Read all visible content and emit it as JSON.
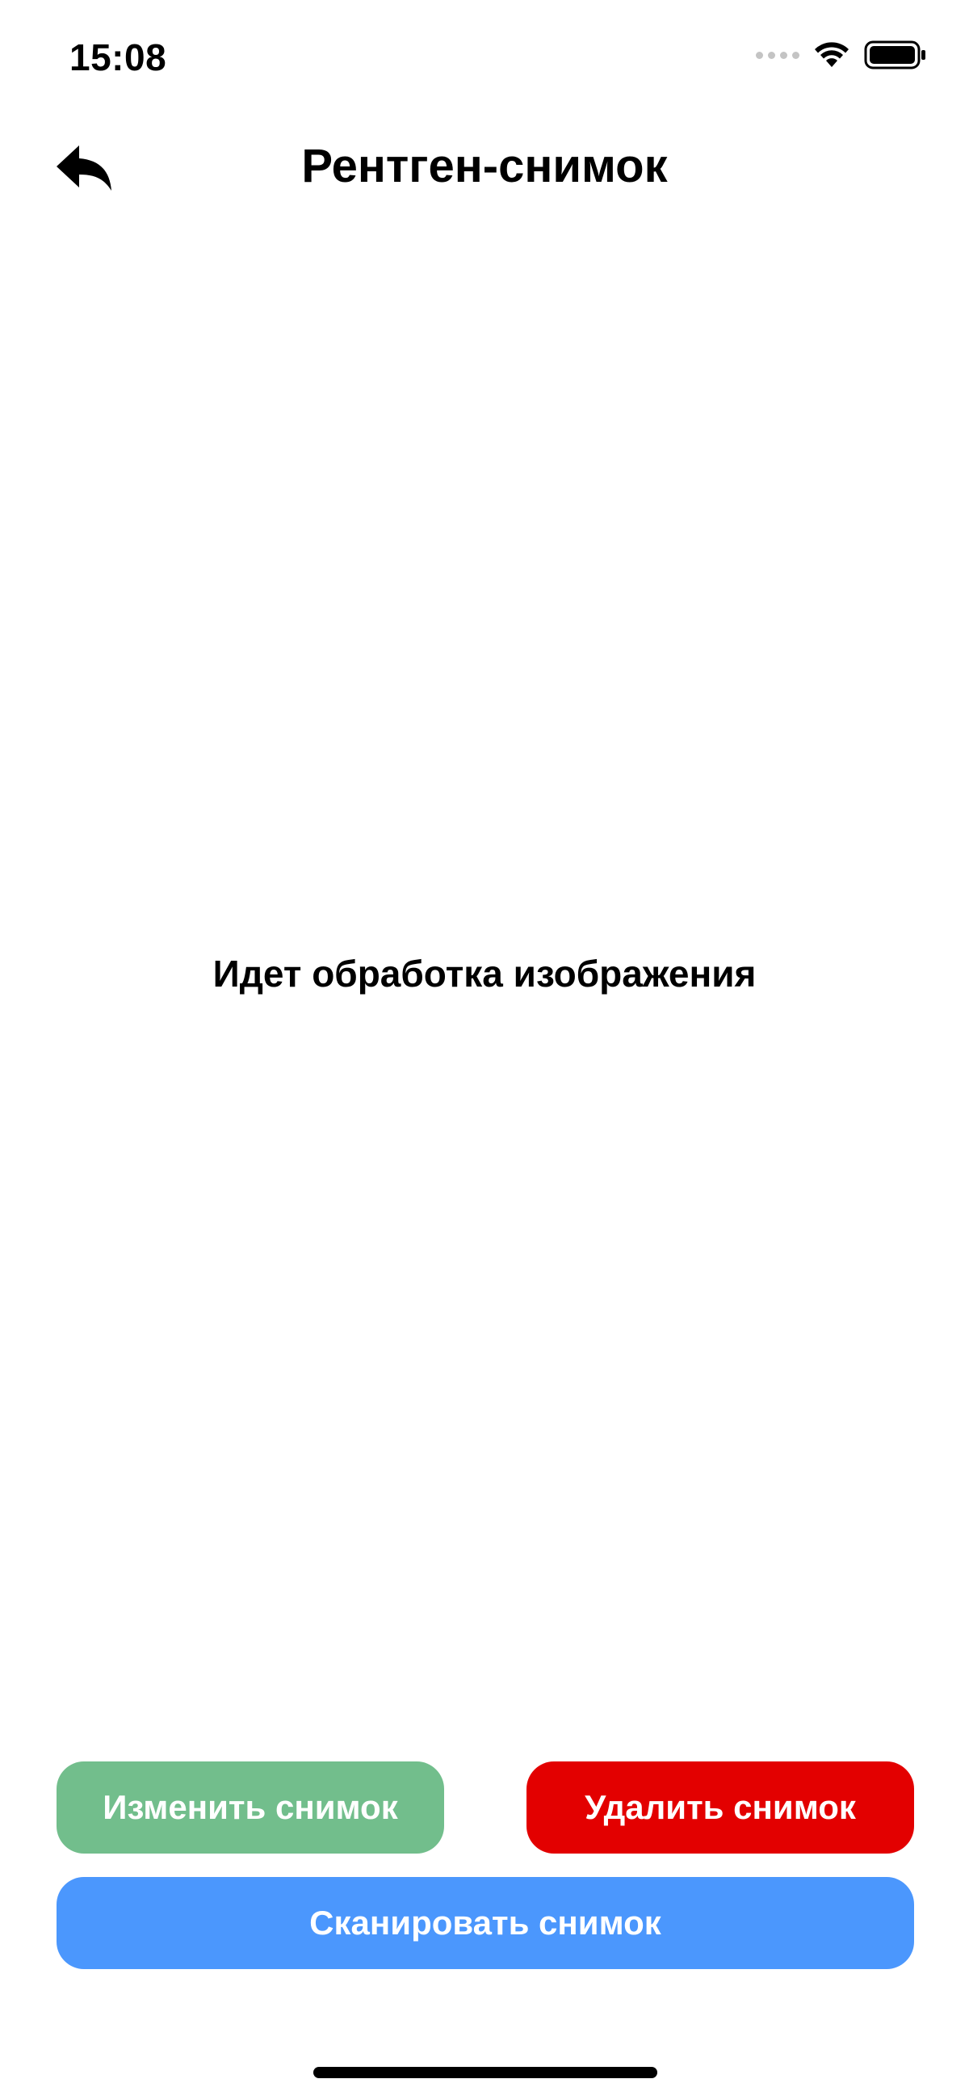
{
  "status_bar": {
    "time": "15:08"
  },
  "header": {
    "title": "Рентген-снимок",
    "back_icon": "reply-arrow-icon"
  },
  "main": {
    "processing_message": "Идет обработка изображения"
  },
  "actions": {
    "change_label": "Изменить снимок",
    "delete_label": "Удалить снимок",
    "scan_label": "Сканировать снимок"
  },
  "colors": {
    "change_button": "#72be8c",
    "delete_button": "#e30000",
    "scan_button": "#4b97fd",
    "background": "#ffffff"
  }
}
